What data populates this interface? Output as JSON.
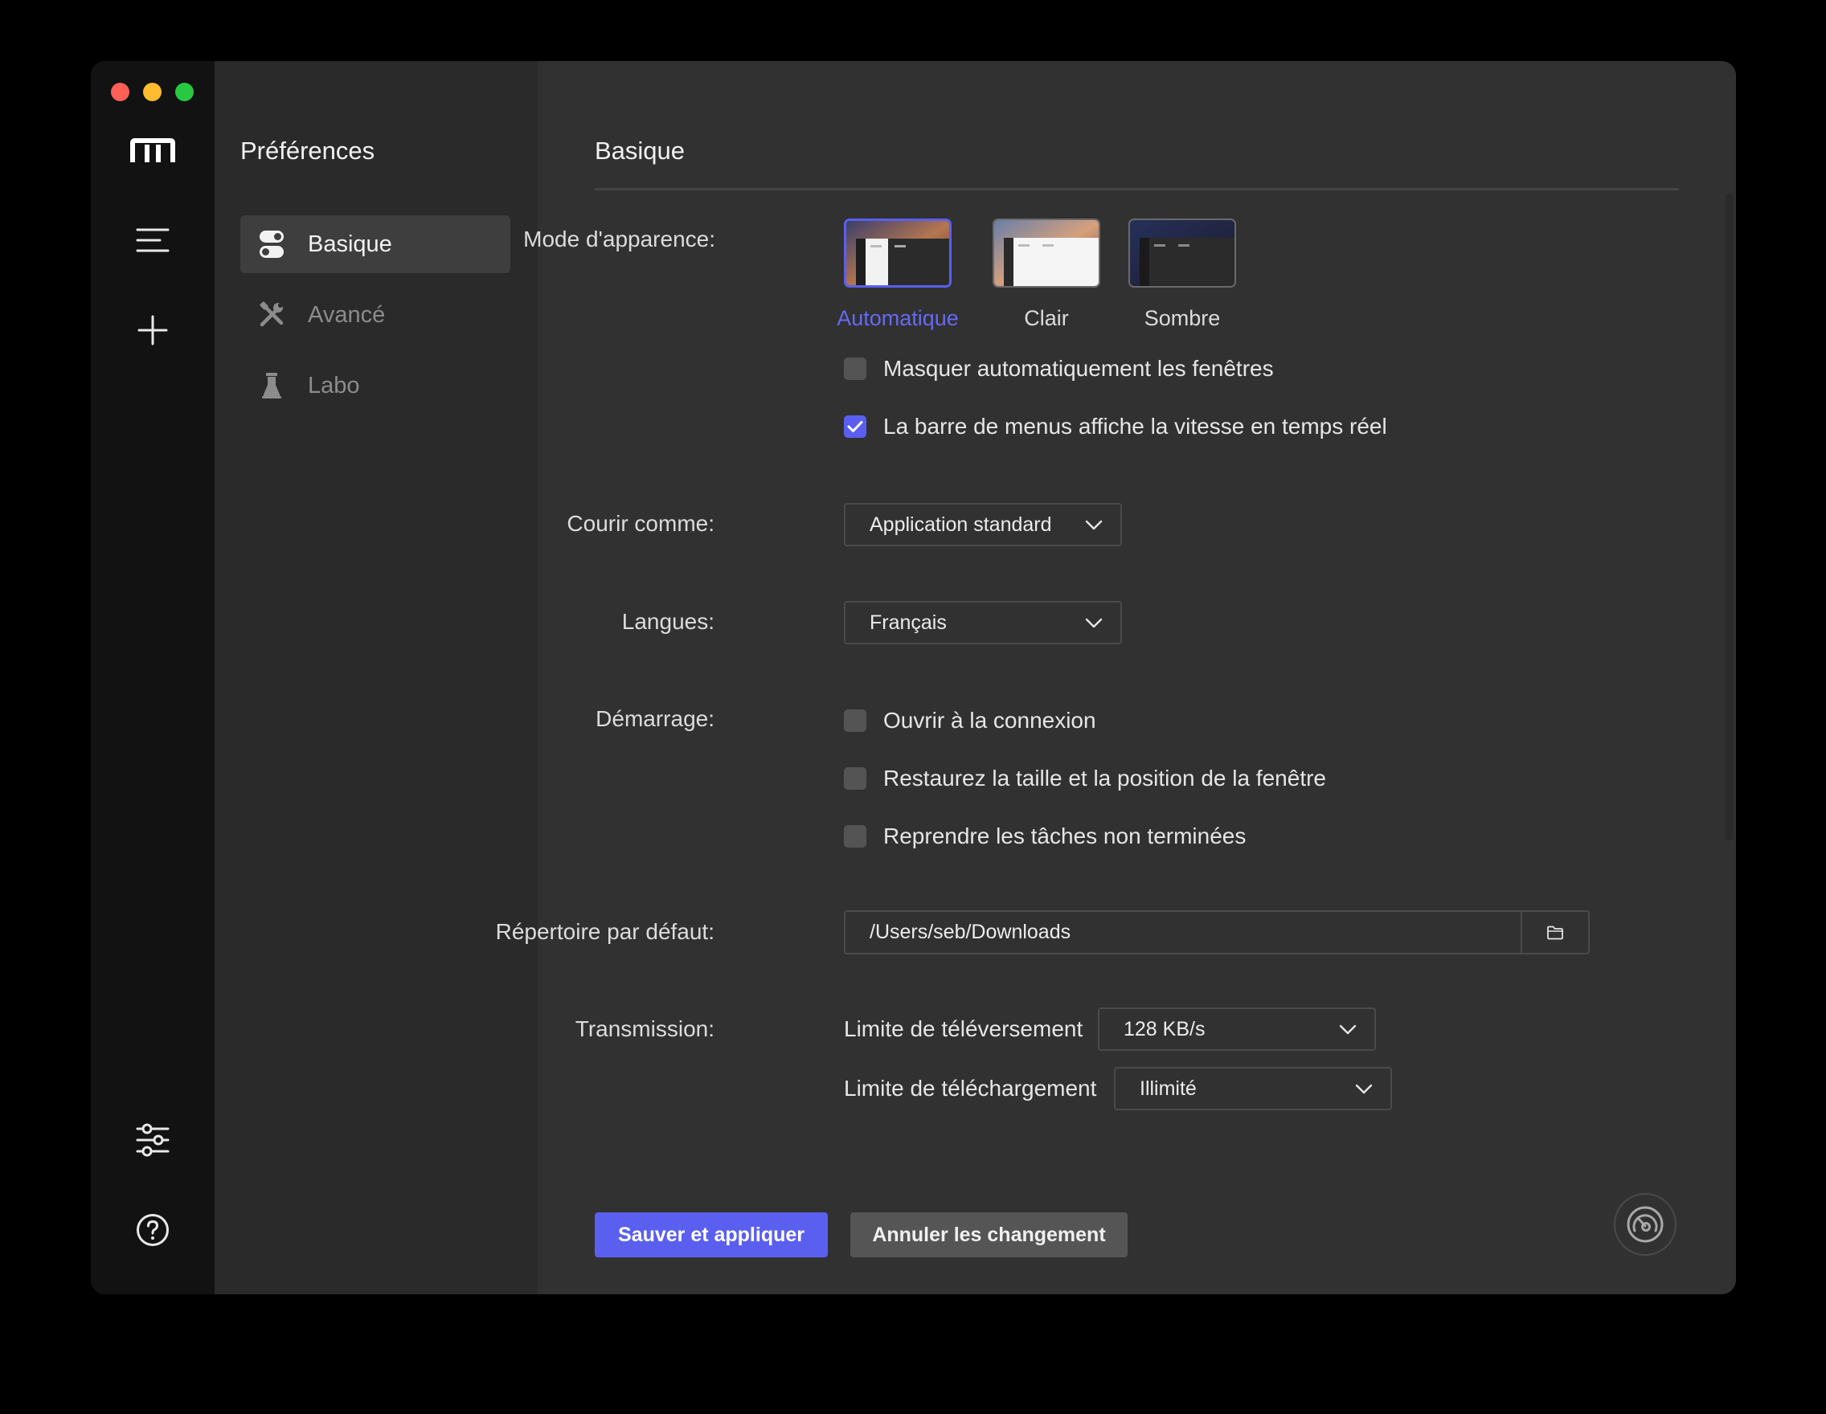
{
  "window": {
    "controls": [
      "close",
      "minimize",
      "maximize"
    ]
  },
  "rail": {
    "logo_icon": "logo-m-icon",
    "items": [
      {
        "name": "task-list",
        "icon": "menu-icon"
      },
      {
        "name": "add-task",
        "icon": "plus-icon"
      },
      {
        "name": "preferences",
        "icon": "sliders-icon"
      },
      {
        "name": "help",
        "icon": "help-icon"
      }
    ]
  },
  "sidebar": {
    "title": "Préférences",
    "items": [
      {
        "label": "Basique",
        "icon": "toggle-icon",
        "active": true
      },
      {
        "label": "Avancé",
        "icon": "tools-icon",
        "active": false
      },
      {
        "label": "Labo",
        "icon": "flask-icon",
        "active": false
      }
    ]
  },
  "main": {
    "title": "Basique",
    "appearance": {
      "label": "Mode d'apparence:",
      "options": [
        {
          "label": "Automatique",
          "selected": true
        },
        {
          "label": "Clair",
          "selected": false
        },
        {
          "label": "Sombre",
          "selected": false
        }
      ]
    },
    "auto_hide": {
      "label": "Masquer automatiquement les fenêtres",
      "checked": false
    },
    "menubar_speed": {
      "label": "La barre de menus affiche la vitesse en temps réel",
      "checked": true
    },
    "run_as": {
      "label": "Courir comme:",
      "value": "Application standard"
    },
    "language": {
      "label": "Langues:",
      "value": "Français"
    },
    "startup": {
      "label": "Démarrage:",
      "options": [
        {
          "label": "Ouvrir à la connexion",
          "checked": false
        },
        {
          "label": "Restaurez la taille et la position de la fenêtre",
          "checked": false
        },
        {
          "label": "Reprendre les tâches non terminées",
          "checked": false
        }
      ]
    },
    "download_dir": {
      "label": "Répertoire par défaut:",
      "value": "/Users/seb/Downloads",
      "button_icon": "folder-icon"
    },
    "transmission": {
      "label": "Transmission:",
      "upload_label": "Limite de téléversement",
      "upload_value": "128 KB/s",
      "download_label": "Limite de téléchargement",
      "download_value": "Illimité"
    },
    "buttons": {
      "save": "Sauver et appliquer",
      "cancel": "Annuler les changement"
    },
    "speedometer_icon": "speedometer-icon"
  },
  "colors": {
    "accent": "#5a5ff0",
    "accent_text": "#6669f2",
    "rail_bg": "#121212",
    "sidebar_bg": "#2a2a2a",
    "main_bg": "#313131"
  }
}
